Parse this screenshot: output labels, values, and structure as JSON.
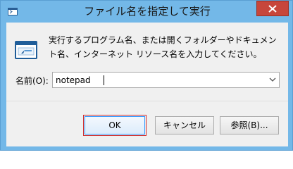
{
  "window": {
    "title": "ファイル名を指定して実行"
  },
  "dialog": {
    "description": "実行するプログラム名、または開くフォルダーやドキュメント名、インターネット リソース名を入力してください。",
    "open_label": "名前(O):",
    "input_value": "notepad"
  },
  "buttons": {
    "ok": "OK",
    "cancel": "キャンセル",
    "browse": "参照(B)..."
  },
  "colors": {
    "titlebar": "#73b8e8",
    "close_button": "#c7463b",
    "ok_highlight": "#cf2c2c",
    "focus_border": "#3399ff"
  },
  "icons": {
    "app": "run-app-icon",
    "close": "close-icon",
    "dialog": "run-dialog-icon",
    "dropdown": "chevron-down-icon"
  }
}
